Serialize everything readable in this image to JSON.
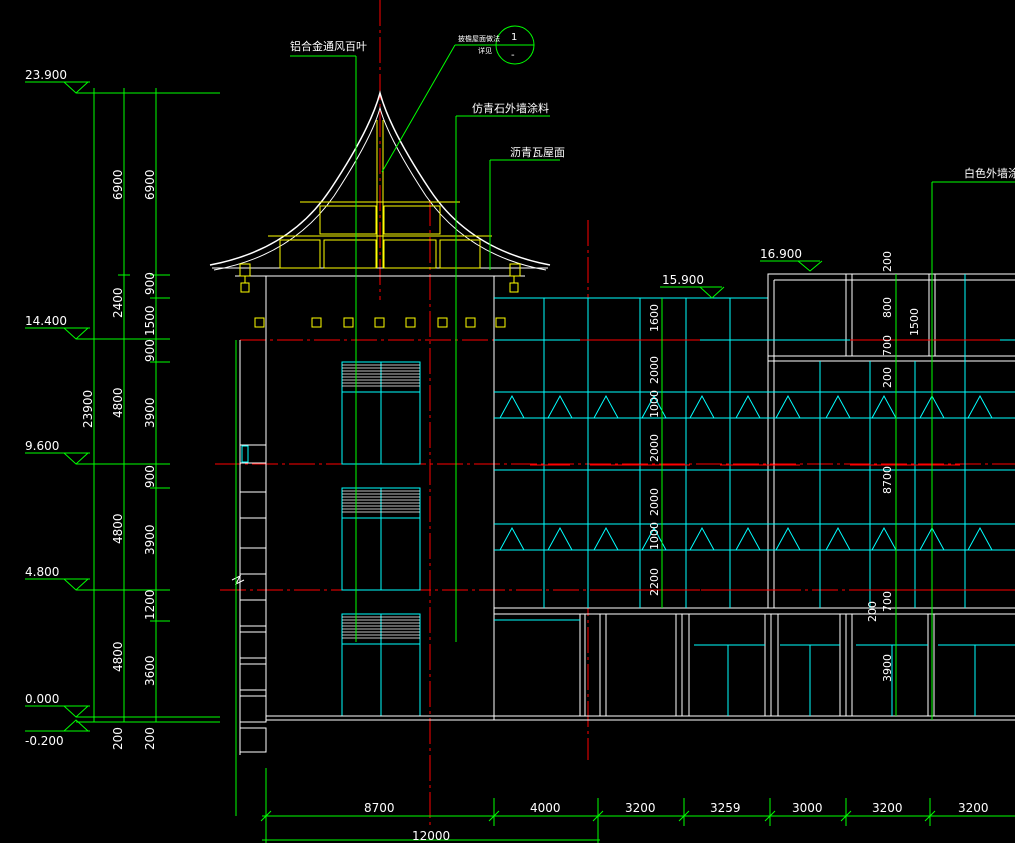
{
  "colors": {
    "background": "#000000",
    "white": "#ffffff",
    "green": "#00ff00",
    "cyan": "#00ffff",
    "yellow": "#ffff00",
    "red": "#ff0000",
    "redDark": "#c00000"
  },
  "elevations": [
    "23.900",
    "14.400",
    "9.600",
    "4.800",
    "0.000",
    "-0.200",
    "16.900",
    "15.900"
  ],
  "dims_left_outer": [
    "6900",
    "2400",
    "4800",
    "4800",
    "4800",
    "200"
  ],
  "dims_left_inner": [
    "6900",
    "900",
    "1500",
    "900",
    "3900",
    "900",
    "3900",
    "1200",
    "3600",
    "200"
  ],
  "dim_total_vertical": "23900",
  "dims_mid_vertical": [
    "1600",
    "2000",
    "1000",
    "2000",
    "2000",
    "1000",
    "2200"
  ],
  "dims_right_vertical": [
    "200",
    "800",
    "1500",
    "700",
    "200",
    "8700",
    "700",
    "200",
    "3900"
  ],
  "dims_bottom": [
    "8700",
    "4000",
    "3200",
    "3259",
    "3000",
    "3200",
    "3200"
  ],
  "dim_bottom_total": "12000",
  "notes": {
    "aluminum_louver": "铝合金通风百叶",
    "detail_small_1": "披檐屋面做法",
    "detail_small_2": "详见",
    "callout_top": "1",
    "callout_bottom": "-",
    "stone_paint": "仿青石外墙涂料",
    "asphalt_tile_roof": "沥青瓦屋面",
    "white_paint": "白色外墙涂料"
  }
}
